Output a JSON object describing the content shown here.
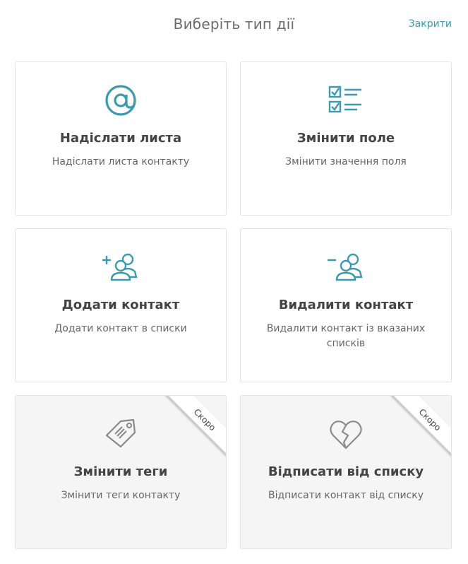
{
  "header": {
    "title": "Виберіть тип дії",
    "close_label": "Закрити"
  },
  "colors": {
    "accent": "#3b9aad",
    "muted_icon": "#8a8a8a",
    "card_border": "#e3e3e3",
    "disabled_bg": "#f5f5f5"
  },
  "cards": [
    {
      "icon": "at-sign-icon",
      "title": "Надіслати листа",
      "description": "Надіслати листа контакту",
      "enabled": true
    },
    {
      "icon": "checklist-icon",
      "title": "Змінити поле",
      "description": "Змінити значення поля",
      "enabled": true
    },
    {
      "icon": "add-user-icon",
      "title": "Додати контакт",
      "description": "Додати контакт в списки",
      "enabled": true
    },
    {
      "icon": "remove-user-icon",
      "title": "Видалити контакт",
      "description": "Видалити контакт із вказаних списків",
      "enabled": true
    },
    {
      "icon": "tag-icon",
      "title": "Змінити теги",
      "description": "Змінити теги контакту",
      "enabled": false,
      "badge": "Скоро"
    },
    {
      "icon": "broken-heart-icon",
      "title": "Відписати від списку",
      "description": "Відписати контакт від списку",
      "enabled": false,
      "badge": "Скоро"
    }
  ]
}
